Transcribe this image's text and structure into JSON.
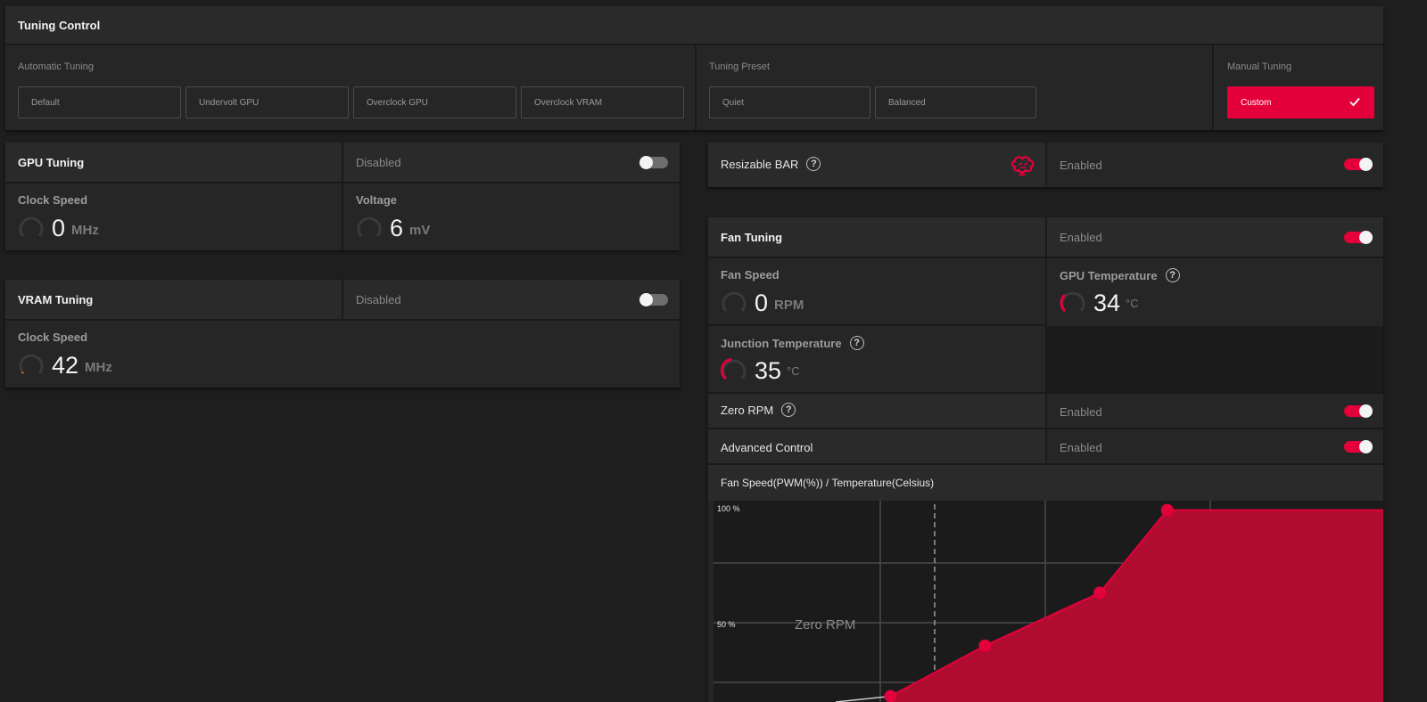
{
  "tuning_control": {
    "title": "Tuning Control",
    "automatic": {
      "label": "Automatic Tuning",
      "buttons": [
        "Default",
        "Undervolt GPU",
        "Overclock GPU",
        "Overclock VRAM"
      ]
    },
    "preset": {
      "label": "Tuning Preset",
      "buttons": [
        "Quiet",
        "Balanced"
      ]
    },
    "manual": {
      "label": "Manual Tuning",
      "button": "Custom"
    }
  },
  "gpu_tuning": {
    "title": "GPU Tuning",
    "state": "Disabled",
    "enabled": false,
    "clock": {
      "label": "Clock Speed",
      "value": "0",
      "unit": "MHz"
    },
    "voltage": {
      "label": "Voltage",
      "value": "6",
      "unit": "mV"
    }
  },
  "vram_tuning": {
    "title": "VRAM Tuning",
    "state": "Disabled",
    "enabled": false,
    "clock": {
      "label": "Clock Speed",
      "value": "42",
      "unit": "MHz"
    }
  },
  "resizable_bar": {
    "label": "Resizable BAR",
    "state": "Enabled",
    "enabled": true,
    "help": "?"
  },
  "fan_tuning": {
    "title": "Fan Tuning",
    "state": "Enabled",
    "enabled": true,
    "fan_speed": {
      "label": "Fan Speed",
      "value": "0",
      "unit": "RPM"
    },
    "gpu_temp": {
      "label": "GPU Temperature",
      "value": "34",
      "unit": "°C",
      "help": "?"
    },
    "junction_temp": {
      "label": "Junction Temperature",
      "value": "35",
      "unit": "°C",
      "help": "?"
    },
    "zero_rpm": {
      "label": "Zero RPM",
      "state": "Enabled",
      "enabled": true,
      "help": "?"
    },
    "advanced": {
      "label": "Advanced Control",
      "state": "Enabled",
      "enabled": true
    }
  },
  "colors": {
    "accent": "#e4003b",
    "fill": "#b00c30",
    "panel": "#262626",
    "background": "#1e1e1e"
  },
  "chart_data": {
    "type": "area",
    "title": "Fan Speed(PWM(%)) / Temperature(Celsius)",
    "y_tick_labels": [
      "100 %",
      "50 %"
    ],
    "zero_rpm_label": "Zero RPM",
    "points": [
      {
        "x": 0.27,
        "y": 18
      },
      {
        "x": 0.41,
        "y": 40
      },
      {
        "x": 0.58,
        "y": 63
      },
      {
        "x": 0.68,
        "y": 99
      }
    ],
    "ylim": [
      0,
      100
    ]
  }
}
